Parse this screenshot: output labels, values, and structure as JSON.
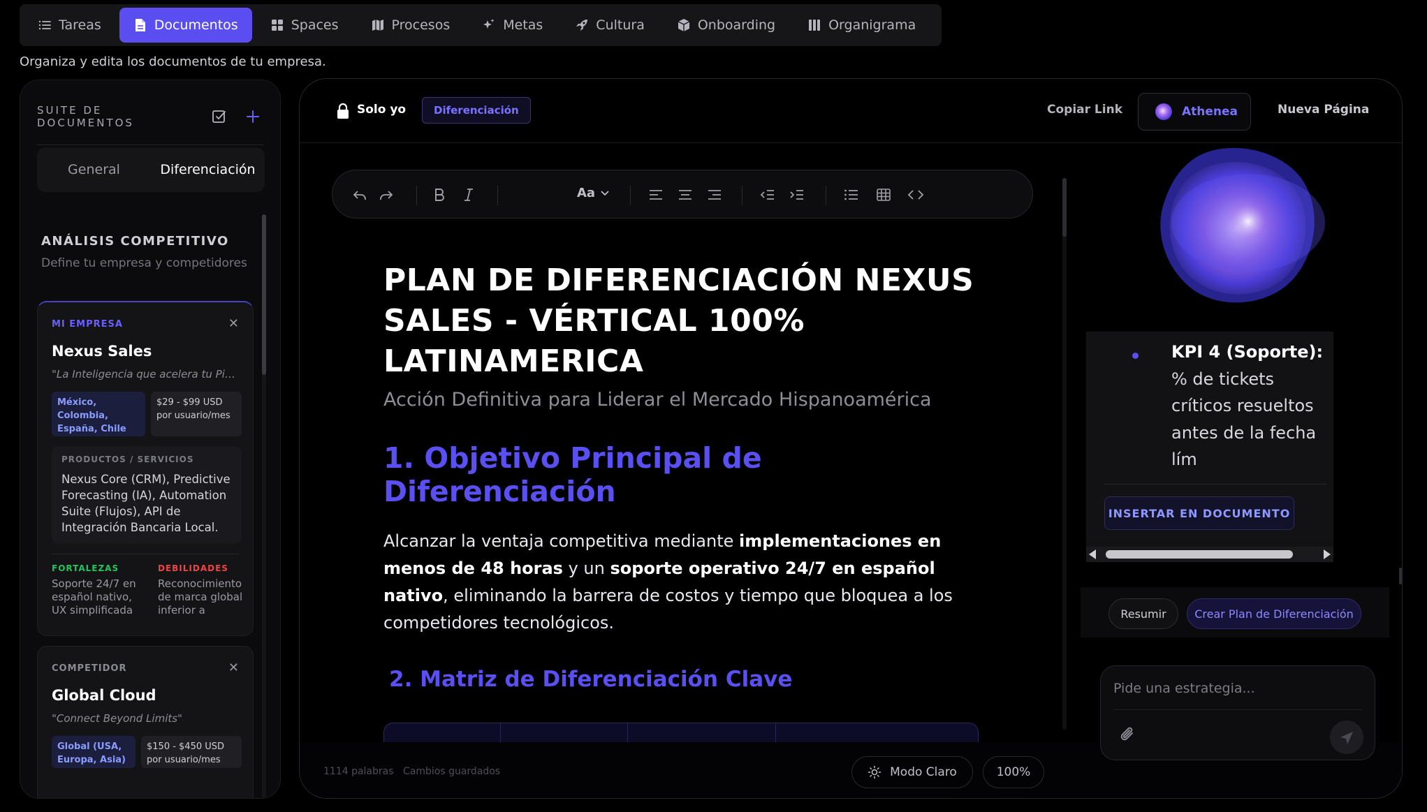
{
  "nav": {
    "tabs": [
      {
        "label": "Tareas",
        "icon": "list-icon"
      },
      {
        "label": "Documentos",
        "icon": "document-icon"
      },
      {
        "label": "Spaces",
        "icon": "grid-icon"
      },
      {
        "label": "Procesos",
        "icon": "map-icon"
      },
      {
        "label": "Metas",
        "icon": "sparkle-icon"
      },
      {
        "label": "Cultura",
        "icon": "rocket-icon"
      },
      {
        "label": "Onboarding",
        "icon": "box-icon"
      },
      {
        "label": "Organigrama",
        "icon": "columns-icon"
      }
    ],
    "active": "Documentos",
    "subtitle": "Organiza y edita los documentos de tu empresa."
  },
  "sidebar": {
    "title": "SUITE DE DOCUMENTOS",
    "segments": [
      "General",
      "Diferenciación"
    ],
    "active_segment": "Diferenciación",
    "section_title": "ANÁLISIS COMPETITIVO",
    "section_subtitle": "Define tu empresa y competidores",
    "my_company": {
      "tag": "MI EMPRESA",
      "name": "Nexus Sales",
      "tagline": "\"La Inteligencia que acelera tu Pipeline\"",
      "regions": "México, Colombia, España, Chile",
      "price": "$29 - $99 USD por usuario/mes",
      "products_label": "PRODUCTOS / SERVICIOS",
      "products": "Nexus Core (CRM), Predictive Forecasting (IA), Automation Suite (Flujos), API de Integración Bancaria Local.",
      "strengths_label": "FORTALEZAS",
      "strengths": "Soporte 24/7 en español nativo, UX simplificada para equipos comerciales",
      "weaknesses_label": "DEBILIDADES",
      "weaknesses": "Reconocimiento de marca global inferior a competidores"
    },
    "competitor": {
      "tag": "COMPETIDOR",
      "name": "Global Cloud",
      "tagline": "\"Connect Beyond Limits\"",
      "regions": "Global (USA, Europa, Asia)",
      "price": "$150 - $450 USD por usuario/mes"
    }
  },
  "editor": {
    "visibility": "Solo yo",
    "doc_badge": "Diferenciación",
    "copy_link": "Copiar Link",
    "assistant_label": "Athenea",
    "new_page": "Nueva Página",
    "font_menu": "Aa",
    "title": "PLAN DE DIFERENCIACIÓN NEXUS SALES - VÉRTICAL 100% LATINAMERICA",
    "subtitle": "Acción Definitiva para Liderar el Mercado Hispanoamérica",
    "h1": "1. Objetivo Principal de Diferenciación",
    "para": {
      "t1": "Alcanzar la ventaja competitiva mediante ",
      "b1": "implementaciones en menos de 48 horas",
      "t2": " y un ",
      "b2": "soporte operativo 24/7 en español nativo",
      "t3": ", eliminando la barrera de costos y tiempo que bloquea a los competidores tecnológicos."
    },
    "h2": "2. Matriz de Diferenciación Clave",
    "word_count": "1114 palabras",
    "save_status": "Cambios guardados",
    "mode_label": "Modo Claro",
    "zoom": "100%"
  },
  "assistant": {
    "kpi_label": "KPI 4 (Soporte):",
    "kpi_text": " % de tickets críticos resueltos antes de la fecha lím",
    "insert_label": "INSERTAR EN DOCUMENTO",
    "actions": [
      "Resumir",
      "Crear Plan de Diferenciación"
    ],
    "input_placeholder": "Pide una estrategia..."
  },
  "colors": {
    "accent": "#5b4ef0",
    "accent_text": "#7b73ff",
    "strength": "#22c55e",
    "weakness": "#ef4444",
    "background": "#000000"
  }
}
